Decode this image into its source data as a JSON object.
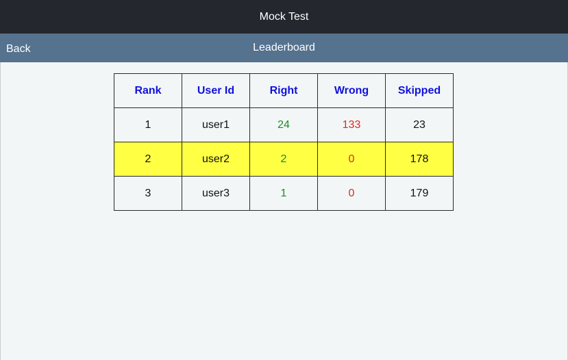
{
  "app": {
    "title": "Mock Test"
  },
  "nav": {
    "back_label": "Back",
    "title": "Leaderboard"
  },
  "colors": {
    "titlebar_bg": "#24272e",
    "navbar_bg": "#55728f",
    "header_text": "#1010dd",
    "right_text": "#1e8a2a",
    "wrong_text": "#ee2222",
    "highlight_row": "#ffff44"
  },
  "leaderboard": {
    "columns": [
      "Rank",
      "User Id",
      "Right",
      "Wrong",
      "Skipped"
    ],
    "rows": [
      {
        "rank": "1",
        "user_id": "user1",
        "right": "24",
        "wrong": "133",
        "skipped": "23",
        "highlighted": false
      },
      {
        "rank": "2",
        "user_id": "user2",
        "right": "2",
        "wrong": "0",
        "skipped": "178",
        "highlighted": true
      },
      {
        "rank": "3",
        "user_id": "user3",
        "right": "1",
        "wrong": "0",
        "skipped": "179",
        "highlighted": false
      }
    ]
  }
}
